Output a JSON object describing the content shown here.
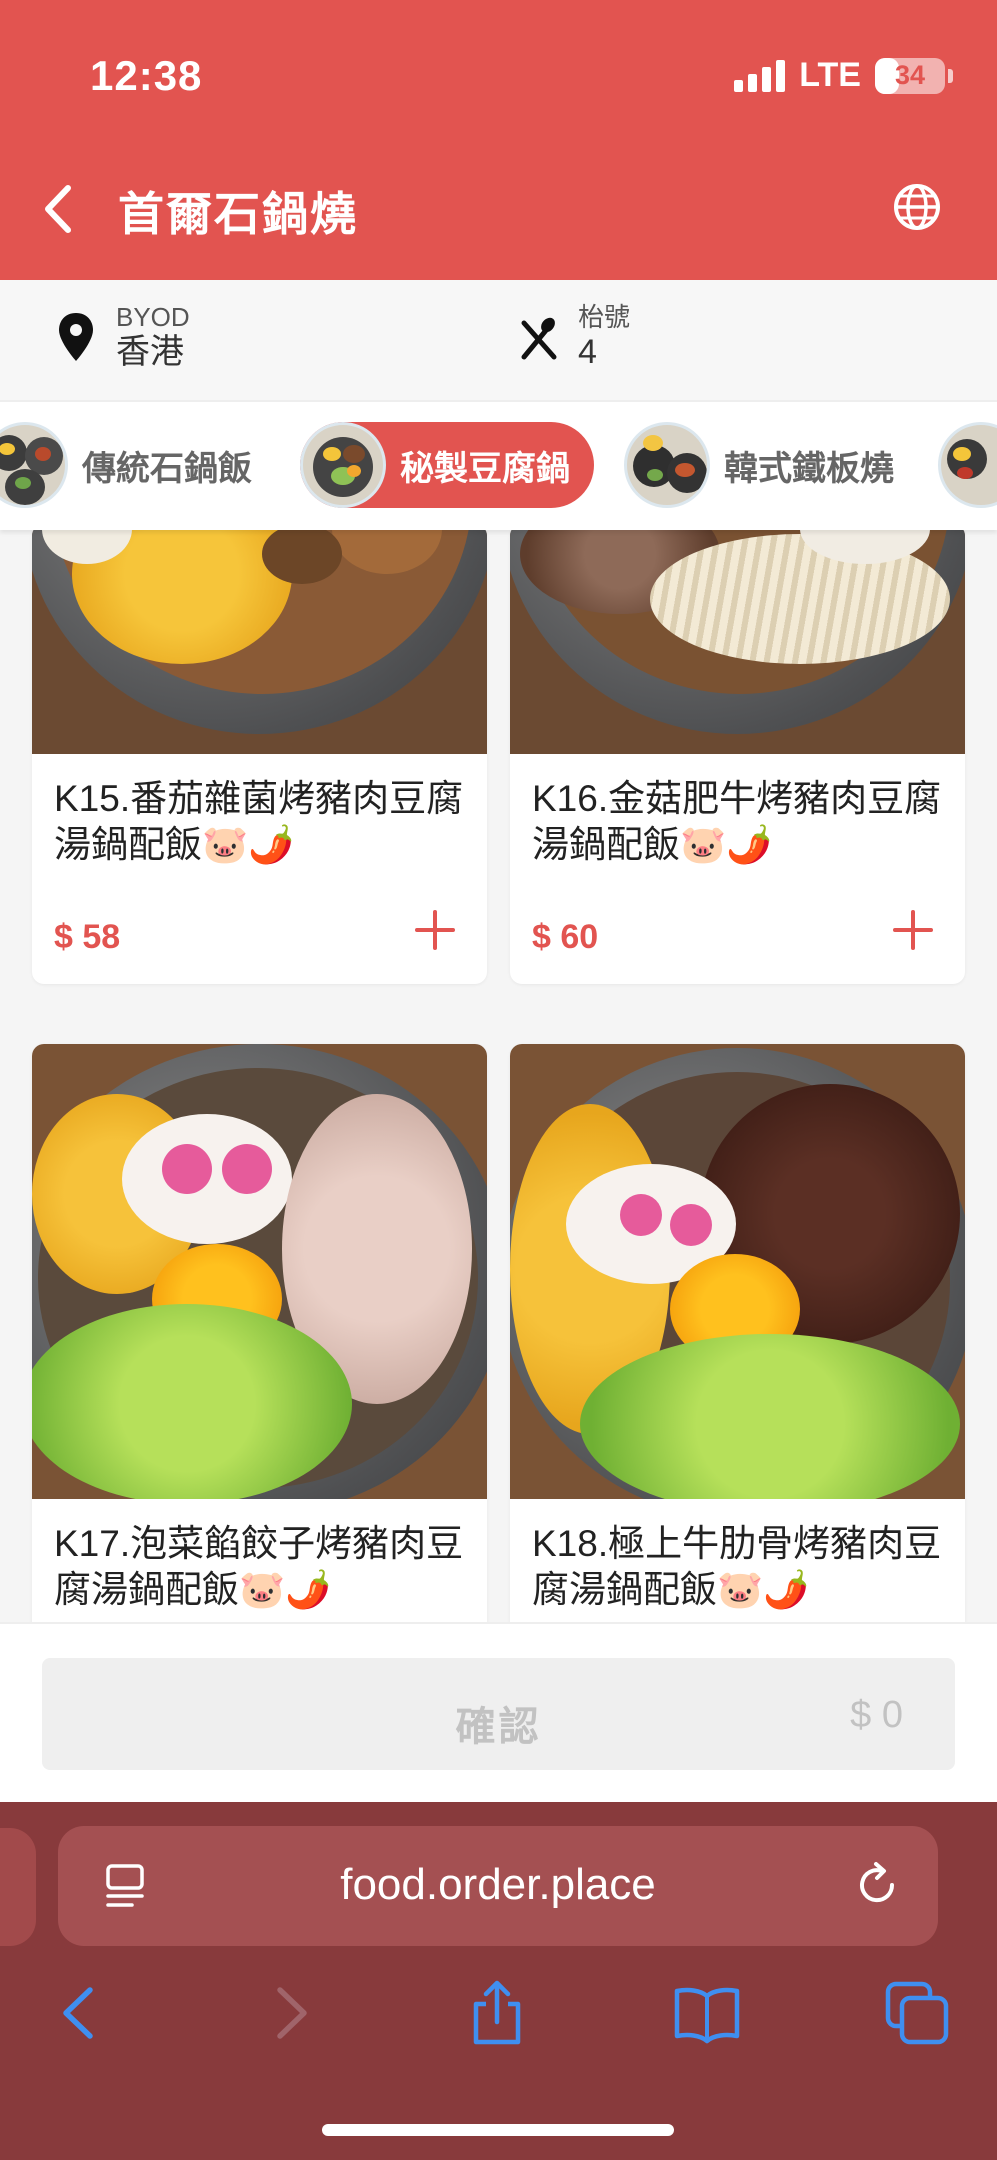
{
  "status": {
    "time": "12:38",
    "network": "LTE",
    "battery": "34",
    "battery_level": 0.34
  },
  "header": {
    "back_icon": "chevron-left-icon",
    "title": "首爾石鍋燒",
    "language_icon": "globe-icon"
  },
  "info": {
    "location": {
      "icon": "map-pin-icon",
      "sub": "BYOD",
      "main": "香港"
    },
    "table": {
      "icon": "utensils-icon",
      "sub": "枱號",
      "main": "4"
    }
  },
  "categories": [
    {
      "label": "傳統石鍋飯",
      "active": false
    },
    {
      "label": "秘製豆腐鍋",
      "active": true
    },
    {
      "label": "韓式鐵板燒",
      "active": false
    }
  ],
  "items": [
    {
      "name": "K15.番茄雜菌烤豬肉豆腐湯鍋配飯🐷🌶️",
      "price": "$ 58"
    },
    {
      "name": "K16.金菇肥牛烤豬肉豆腐湯鍋配飯🐷🌶️",
      "price": "$ 60"
    },
    {
      "name": "K17.泡菜餡餃子烤豬肉豆腐湯鍋配飯🐷🌶️",
      "price": ""
    },
    {
      "name": "K18.極上牛肋骨烤豬肉豆腐湯鍋配飯🐷🌶️",
      "price": ""
    }
  ],
  "confirm": {
    "label": "確認",
    "total": "$ 0"
  },
  "browser": {
    "url": "food.order.place",
    "reader_icon": "reader-icon",
    "reload_icon": "reload-icon",
    "nav_icons": [
      "back-arrow-icon",
      "forward-arrow-icon",
      "share-icon",
      "bookmarks-icon",
      "tabs-icon"
    ]
  },
  "colors": {
    "brand": "#e25450",
    "browser": "#883a3c",
    "text": "#222222",
    "muted": "#c2c2c2"
  }
}
